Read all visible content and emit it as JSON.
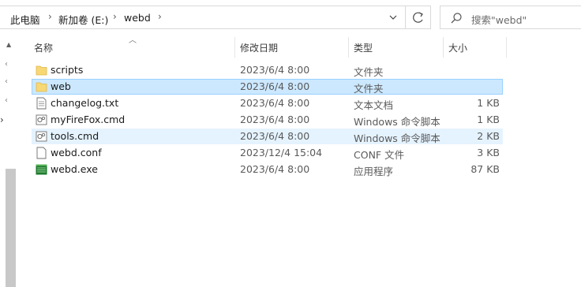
{
  "address_bar": {
    "crumbs": [
      "此电脑",
      "新加卷 (E:)",
      "webd"
    ]
  },
  "search": {
    "placeholder": "搜索\"webd\""
  },
  "columns": {
    "name": "名称",
    "date": "修改日期",
    "type": "类型",
    "size": "大小"
  },
  "files": [
    {
      "name": "scripts",
      "date": "2023/6/4 8:00",
      "type": "文件夹",
      "size": "",
      "icon": "folder-icon"
    },
    {
      "name": "web",
      "date": "2023/6/4 8:00",
      "type": "文件夹",
      "size": "",
      "icon": "folder-icon"
    },
    {
      "name": "changelog.txt",
      "date": "2023/6/4 8:00",
      "type": "文本文档",
      "size": "1 KB",
      "icon": "text-file-icon"
    },
    {
      "name": "myFireFox.cmd",
      "date": "2023/6/4 8:00",
      "type": "Windows 命令脚本",
      "size": "1 KB",
      "icon": "script-file-icon"
    },
    {
      "name": "tools.cmd",
      "date": "2023/6/4 8:00",
      "type": "Windows 命令脚本",
      "size": "2 KB",
      "icon": "script-file-icon"
    },
    {
      "name": "webd.conf",
      "date": "2023/12/4 15:04",
      "type": "CONF 文件",
      "size": "3 KB",
      "icon": "blank-file-icon"
    },
    {
      "name": "webd.exe",
      "date": "2023/6/4 8:00",
      "type": "应用程序",
      "size": "87 KB",
      "icon": "exe-file-icon"
    }
  ],
  "colors": {
    "selected_bg": "#cce8ff",
    "selected_border": "#99d1ff",
    "hover_bg": "#e5f3ff",
    "folder": "#f8d775"
  }
}
